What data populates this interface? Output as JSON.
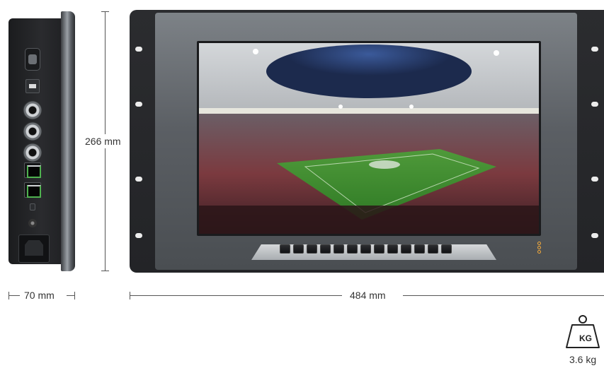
{
  "dimensions": {
    "height_label": "266 mm",
    "depth_label": "70 mm",
    "width_label": "484 mm"
  },
  "weight": {
    "unit_label": "KG",
    "value_label": "3.6 kg"
  },
  "colors": {
    "accent_logo": "#f2a93b",
    "port_green": "#4fb24f",
    "chassis": "#232427"
  },
  "icons": [
    "weight-icon",
    "brand-logo-icon",
    "bnc-connector-icon",
    "ethernet-port-icon",
    "power-inlet-icon"
  ]
}
